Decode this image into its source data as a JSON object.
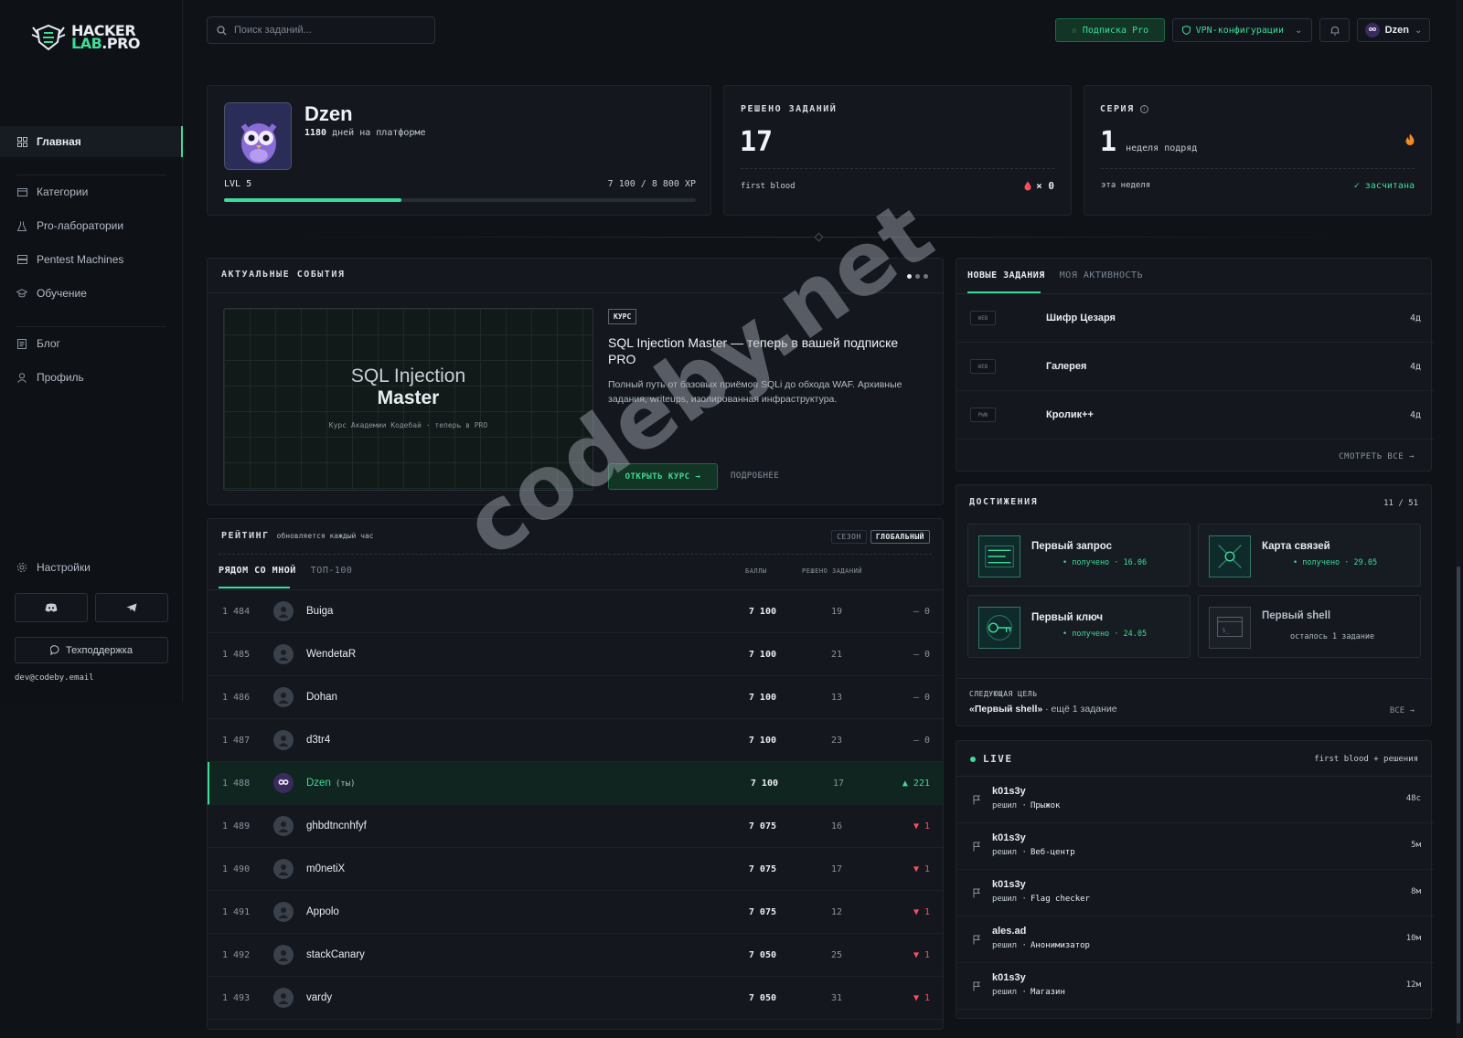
{
  "brand": {
    "line1": "HACKER",
    "line2a": "LAB",
    "line2b": ".PRO"
  },
  "search": {
    "placeholder": "Поиск заданий..."
  },
  "topbar": {
    "pro_label": "Подписка Pro",
    "vpn_label": "VPN-конфигурации",
    "user_name": "Dzen"
  },
  "sidebar": {
    "items": [
      {
        "label": "Главная",
        "icon": "grid-icon",
        "active": true
      },
      {
        "label": "Категории",
        "icon": "folder-icon"
      },
      {
        "label": "Pro-лаборатории",
        "icon": "flask-icon"
      },
      {
        "label": "Pentest Machines",
        "icon": "server-icon"
      },
      {
        "label": "Обучение",
        "icon": "graduation-icon"
      },
      {
        "label": "Блог",
        "icon": "blog-icon"
      },
      {
        "label": "Профиль",
        "icon": "user-icon"
      }
    ],
    "settings_label": "Настройки",
    "support_label": "Техподдержка",
    "email": "dev@codeby.email"
  },
  "profile": {
    "name": "Dzen",
    "days": "1180",
    "days_suffix": "дней на платформе",
    "level": "LVL 5",
    "xp": "7 100 / 8 800 XP",
    "xp_progress": 0.375
  },
  "solved": {
    "label": "РЕШЕНО ЗАДАНИЙ",
    "value": "17",
    "first_blood_label": "first blood",
    "first_blood_value": "× 0"
  },
  "streak": {
    "label": "СЕРИЯ",
    "value": "1",
    "suffix": "неделя подряд",
    "week_label": "эта неделя",
    "week_status": "✓ засчитана"
  },
  "events": {
    "title": "АКТУАЛЬНЫЕ СОБЫТИЯ",
    "banner_line1": "SQL Injection",
    "banner_line2": "Master",
    "banner_sub": "Курс Академии Кодебай · теперь в PRO",
    "tag": "КУРС",
    "headline": "SQL Injection Master — теперь в вашей подписке PRO",
    "description": "Полный путь от базовых приёмов SQLi до обхода WAF. Архивные задания, writeups, изолированная инфраструктура.",
    "primary_btn": "ОТКРЫТЬ КУРС →",
    "secondary_btn": "ПОДРОБНЕЕ"
  },
  "tasks": {
    "tab_new": "НОВЫЕ ЗАДАНИЯ",
    "tab_activity": "МОЯ АКТИВНОСТЬ",
    "items": [
      {
        "tag": "WEB",
        "name": "Шифр Цезаря",
        "age": "4д"
      },
      {
        "tag": "WEB",
        "name": "Галерея",
        "age": "4д"
      },
      {
        "tag": "PWN",
        "name": "Кролик++",
        "age": "4д"
      }
    ],
    "see_all": "СМОТРЕТЬ ВСЕ →"
  },
  "rating": {
    "title": "РЕЙТИНГ",
    "subtitle": "обновляется каждый час",
    "season": "СЕЗОН",
    "global": "ГЛОБАЛЬНЫЙ",
    "tab_near": "РЯДОМ СО МНОЙ",
    "tab_top": "ТОП-100",
    "col_points": "БАЛЛЫ",
    "col_solved": "РЕШЕНО ЗАДАНИЙ",
    "rows": [
      {
        "rank": "1 484",
        "name": "Buiga",
        "points": "7 100",
        "solved": "19",
        "delta": "– 0",
        "dir": "flat"
      },
      {
        "rank": "1 485",
        "name": "WendetaR",
        "points": "7 100",
        "solved": "21",
        "delta": "– 0",
        "dir": "flat"
      },
      {
        "rank": "1 486",
        "name": "Dohan",
        "points": "7 100",
        "solved": "13",
        "delta": "– 0",
        "dir": "flat"
      },
      {
        "rank": "1 487",
        "name": "d3tr4",
        "points": "7 100",
        "solved": "23",
        "delta": "– 0",
        "dir": "flat"
      },
      {
        "rank": "1 488",
        "name": "Dzen",
        "you": "(ты)",
        "points": "7 100",
        "solved": "17",
        "delta": "▲ 221",
        "dir": "up"
      },
      {
        "rank": "1 489",
        "name": "ghbdtncnhfyf",
        "points": "7 075",
        "solved": "16",
        "delta": "▼ 1",
        "dir": "down"
      },
      {
        "rank": "1 490",
        "name": "m0netiX",
        "points": "7 075",
        "solved": "17",
        "delta": "▼ 1",
        "dir": "down"
      },
      {
        "rank": "1 491",
        "name": "Appolo",
        "points": "7 075",
        "solved": "12",
        "delta": "▼ 1",
        "dir": "down"
      },
      {
        "rank": "1 492",
        "name": "stackCanary",
        "points": "7 050",
        "solved": "25",
        "delta": "▼ 1",
        "dir": "down"
      },
      {
        "rank": "1 493",
        "name": "vardy",
        "points": "7 050",
        "solved": "31",
        "delta": "▼ 1",
        "dir": "down"
      }
    ]
  },
  "achievements": {
    "title": "ДОСТИЖЕНИЯ",
    "count": "11 / 51",
    "items": [
      {
        "name": "Первый запрос",
        "status": "• получено · 16.06"
      },
      {
        "name": "Карта связей",
        "status": "• получено · 29.05"
      },
      {
        "name": "Первый ключ",
        "status": "• получено · 24.05"
      },
      {
        "name": "Первый shell",
        "status": "осталось 1 задание"
      }
    ],
    "next_label": "СЛЕДУЮЩАЯ ЦЕЛЬ",
    "next_goal": "«Первый shell»",
    "next_rest": " · ещё 1 задание",
    "all": "ВСЕ →"
  },
  "live": {
    "title": "LIVE",
    "subtitle": "first blood + решения",
    "items": [
      {
        "user": "k01s3y",
        "verb": "решил ·",
        "task": "Прыжок",
        "time": "48с"
      },
      {
        "user": "k01s3y",
        "verb": "решил ·",
        "task": "Веб-центр",
        "time": "5м"
      },
      {
        "user": "k01s3y",
        "verb": "решил ·",
        "task": "Flag checker",
        "time": "8м"
      },
      {
        "user": "ales.ad",
        "verb": "решил ·",
        "task": "Анонимизатор",
        "time": "10м"
      },
      {
        "user": "k01s3y",
        "verb": "решил ·",
        "task": "Магазин",
        "time": "12м"
      }
    ]
  },
  "watermark": "codeby.net",
  "colors": {
    "accent": "#3ddc97",
    "bg": "#0f1217",
    "card": "#14181e",
    "danger": "#ff4d5e"
  }
}
